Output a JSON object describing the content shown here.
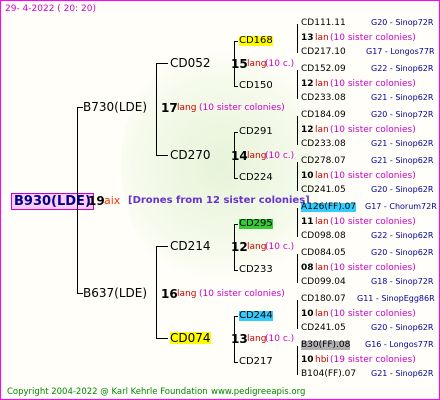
{
  "header": {
    "date": "29-  4-2022 ( 20: 20)"
  },
  "footer": {
    "copyright": "Copyright 2004-2022 @ Karl Kehrle Foundation",
    "url": "www.pedigreeapis.org"
  },
  "root": {
    "name": "B930(LDE)",
    "gen": "19",
    "aix": "aix",
    "drones": "[Drones from 12 sister colonies]"
  },
  "parents": {
    "top": {
      "name": "B730(LDE)",
      "gen": "17",
      "lang": "lang",
      "sis": "(10 sister colonies)"
    },
    "bottom": {
      "name": "B637(LDE)",
      "gen": "16",
      "lang": "lang",
      "sis": "(10 sister colonies)"
    }
  },
  "grand": [
    {
      "name": "CD052",
      "gen": "15",
      "lang": "lang",
      "sis": "(10 c.)"
    },
    {
      "name": "CD270",
      "gen": "14",
      "lang": "lang",
      "sis": "(10 c.)"
    },
    {
      "name": "CD214",
      "gen": "12",
      "lang": "lang",
      "sis": "(10 c.)"
    },
    {
      "name": "CD074",
      "gen": "13",
      "lang": "lang",
      "sis": "(10 c.)"
    }
  ],
  "great": [
    {
      "name": "CD168"
    },
    {
      "name": "CD150"
    },
    {
      "name": "CD291"
    },
    {
      "name": "CD224"
    },
    {
      "name": "CD295"
    },
    {
      "name": "CD233"
    },
    {
      "name": "CD244"
    },
    {
      "name": "CD217"
    }
  ],
  "leaves": [
    {
      "name": "CD111.11",
      "code": "G20 - Sinop72R",
      "gen": "13",
      "lang": "lan",
      "sis": "(10 sister colonies)"
    },
    {
      "name": "CD217.10",
      "code": "G17 - Longos77R"
    },
    {
      "name": "CD152.09",
      "code": "G22 - Sinop62R",
      "gen": "12",
      "lang": "lan",
      "sis": "(10 sister colonies)"
    },
    {
      "name": "CD233.08",
      "code": "G21 - Sinop62R"
    },
    {
      "name": "CD184.09",
      "code": "G20 - Sinop72R",
      "gen": "12",
      "lang": "lan",
      "sis": "(10 sister colonies)"
    },
    {
      "name": "CD233.08",
      "code": "G21 - Sinop62R"
    },
    {
      "name": "CD278.07",
      "code": "G21 - Sinop62R",
      "gen": "10",
      "lang": "lan",
      "sis": "(10 sister colonies)"
    },
    {
      "name": "CD241.05",
      "code": "G20 - Sinop62R"
    },
    {
      "name": "A126(FF).07",
      "code": "G17 - Chorum72R",
      "gen": "11",
      "lang": "lan",
      "sis": "(10 sister colonies)"
    },
    {
      "name": "CD098.08",
      "code": "G22 - Sinop62R"
    },
    {
      "name": "CD084.05",
      "code": "G20 - Sinop62R",
      "gen": "08",
      "lang": "lan",
      "sis": "(10 sister colonies)"
    },
    {
      "name": "CD099.04",
      "code": "G18 - Sinop72R"
    },
    {
      "name": "CD180.07",
      "code": "G11 - SinopEgg86R",
      "gen": "10",
      "lang": "lan",
      "sis": "(10 sister colonies)"
    },
    {
      "name": "CD241.05",
      "code": "G20 - Sinop62R"
    },
    {
      "name": "B30(FF).08",
      "code": "G16 - Longos77R",
      "gen": "10",
      "lang": "hbi",
      "sis": "(19 sister colonies)"
    },
    {
      "name": "B104(FF).07",
      "code": "G21 - Sinop62R"
    }
  ]
}
